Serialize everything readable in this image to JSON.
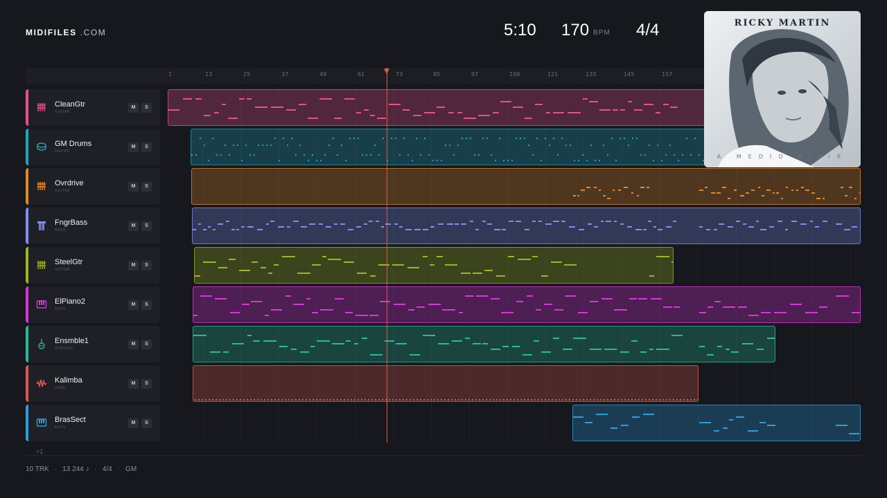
{
  "brand": {
    "bold": "MIDIFILES",
    "light": ".COM"
  },
  "transport": {
    "time": "5:10",
    "bpm": "170",
    "bpm_unit": "BPM",
    "signature": "4/4"
  },
  "ruler": {
    "ticks": [
      "1",
      "13",
      "25",
      "37",
      "49",
      "61",
      "73",
      "85",
      "97",
      "109",
      "121",
      "133",
      "145",
      "157"
    ]
  },
  "playhead": {
    "bar": 71
  },
  "tracks": [
    {
      "name": "CleanGtr",
      "category": "GUITAR",
      "color": "#e8508c",
      "icon": "guitar-grid-icon",
      "mute": "M",
      "solo": "S"
    },
    {
      "name": "GM Drums",
      "category": "DRUMS",
      "color": "#1fa6be",
      "icon": "drum-icon",
      "mute": "M",
      "solo": "S"
    },
    {
      "name": "Ovrdrive",
      "category": "GUITAR",
      "color": "#e58826",
      "icon": "guitar-grid-icon",
      "mute": "M",
      "solo": "S"
    },
    {
      "name": "FngrBass",
      "category": "BASS",
      "color": "#7e8ef0",
      "icon": "bass-icon",
      "mute": "M",
      "solo": "S"
    },
    {
      "name": "SteelGtr",
      "category": "GUITAR",
      "color": "#9fb620",
      "icon": "guitar-grid-icon",
      "mute": "M",
      "solo": "S"
    },
    {
      "name": "ElPiano2",
      "category": "KEYS",
      "color": "#df32df",
      "icon": "keyboard-icon",
      "mute": "M",
      "solo": "S"
    },
    {
      "name": "Ensmble1",
      "category": "STRINGS",
      "color": "#27bb9a",
      "icon": "violin-icon",
      "mute": "M",
      "solo": "S"
    },
    {
      "name": "Kalimba",
      "category": "LEAD",
      "color": "#e3574a",
      "icon": "wave-icon",
      "mute": "M",
      "solo": "S"
    },
    {
      "name": "BrasSect",
      "category": "KEYS",
      "color": "#2a9fe2",
      "icon": "keyboard-icon",
      "mute": "M",
      "solo": "S"
    }
  ],
  "more_tracks": "+1",
  "footer": {
    "tracks": "10 TRK",
    "notes": "13 244 ♪",
    "signature": "4/4",
    "mode": "GM"
  },
  "album": {
    "artist": "RICKY MARTIN",
    "title": "A MEDIO VIVIR"
  }
}
